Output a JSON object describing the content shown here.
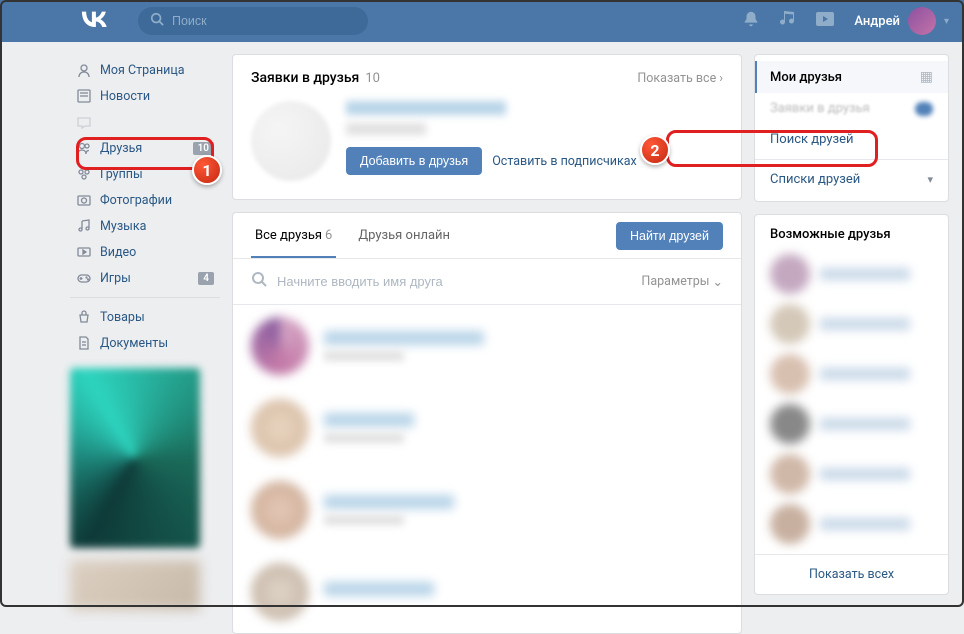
{
  "header": {
    "search_placeholder": "Поиск",
    "user_name": "Андрей"
  },
  "sidebar": {
    "items": [
      {
        "label": "Моя Страница",
        "icon": "◉",
        "badge": null
      },
      {
        "label": "Новости",
        "icon": "▦",
        "badge": null
      },
      {
        "label": "",
        "icon": "✉",
        "badge": null
      },
      {
        "label": "Друзья",
        "icon": "◒",
        "badge": "10"
      },
      {
        "label": "Группы",
        "icon": "◎",
        "badge": null
      },
      {
        "label": "Фотографии",
        "icon": "◯",
        "badge": null
      },
      {
        "label": "Музыка",
        "icon": "♫",
        "badge": null
      },
      {
        "label": "Видео",
        "icon": "▣",
        "badge": null
      },
      {
        "label": "Игры",
        "icon": "⚇",
        "badge": "4"
      },
      {
        "label": "Товары",
        "icon": "▫",
        "badge": null
      },
      {
        "label": "Документы",
        "icon": "▤",
        "badge": null
      }
    ]
  },
  "requests": {
    "title": "Заявки в друзья",
    "count": "10",
    "show_all": "Показать все",
    "add_btn": "Добавить в друзья",
    "keep_sub": "Оставить в подписчиках"
  },
  "friends": {
    "tab_all": "Все друзья",
    "tab_all_count": "6",
    "tab_online": "Друзья онлайн",
    "find_btn": "Найти друзей",
    "search_placeholder": "Начните вводить имя друга",
    "params": "Параметры"
  },
  "rnav": {
    "my_friends": "Мои друзья",
    "requests": "Заявки в друзья",
    "search": "Поиск друзей",
    "lists": "Списки друзей"
  },
  "possible": {
    "title": "Возможные друзья",
    "show_all": "Показать всех"
  },
  "annotations": {
    "n1": "1",
    "n2": "2"
  }
}
